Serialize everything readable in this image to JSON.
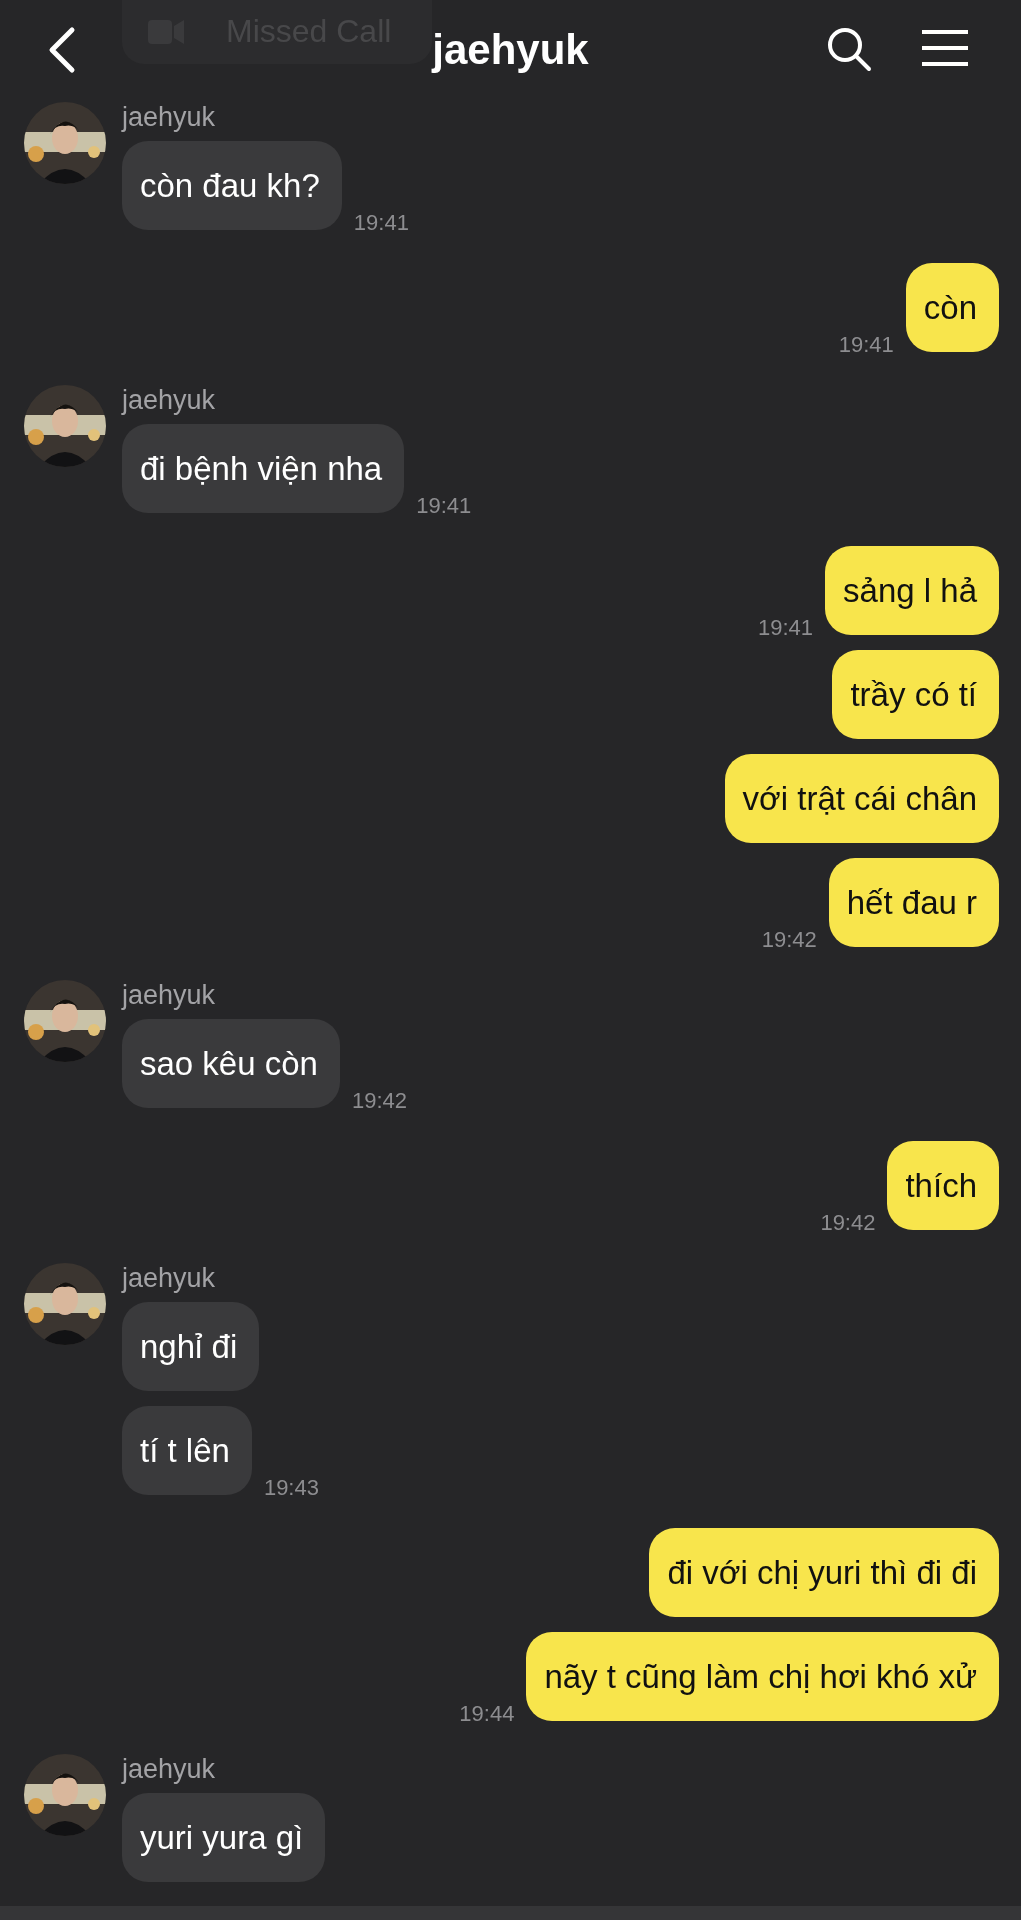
{
  "header": {
    "title": "jaehyuk"
  },
  "faded_message": {
    "text": "Missed Call"
  },
  "groups": [
    {
      "kind": "them",
      "name": "jaehyuk",
      "messages": [
        {
          "text": "còn đau kh?",
          "time": "19:41"
        }
      ]
    },
    {
      "kind": "me",
      "messages": [
        {
          "text": "còn",
          "time": "19:41"
        }
      ]
    },
    {
      "kind": "them",
      "name": "jaehyuk",
      "messages": [
        {
          "text": "đi bệnh viện nha",
          "time": "19:41"
        }
      ]
    },
    {
      "kind": "me",
      "messages": [
        {
          "text": "sảng l hả",
          "time": "19:41"
        },
        {
          "text": "trầy có tí"
        },
        {
          "text": "với trật cái chân"
        },
        {
          "text": "hết đau r",
          "time": "19:42"
        }
      ]
    },
    {
      "kind": "them",
      "name": "jaehyuk",
      "messages": [
        {
          "text": "sao kêu còn",
          "time": "19:42"
        }
      ]
    },
    {
      "kind": "me",
      "messages": [
        {
          "text": "thích",
          "time": "19:42"
        }
      ]
    },
    {
      "kind": "them",
      "name": "jaehyuk",
      "messages": [
        {
          "text": "nghỉ đi"
        },
        {
          "text": "tí t lên",
          "time": "19:43"
        }
      ]
    },
    {
      "kind": "me",
      "messages": [
        {
          "text": "đi với chị yuri thì đi đi"
        },
        {
          "text": "nãy t cũng làm chị hơi khó xử",
          "time": "19:44"
        }
      ]
    },
    {
      "kind": "them",
      "name": "jaehyuk",
      "messages": [
        {
          "text": "yuri yura gì"
        }
      ]
    }
  ]
}
